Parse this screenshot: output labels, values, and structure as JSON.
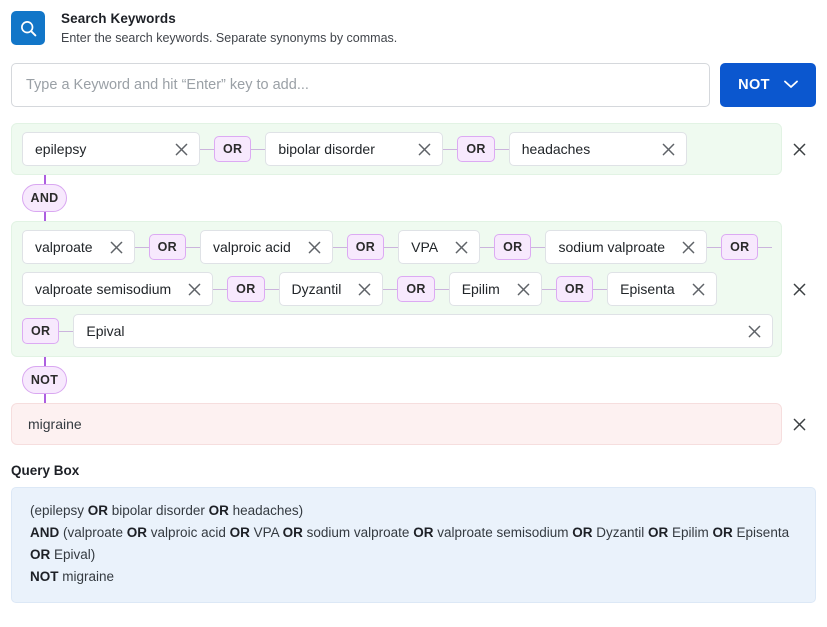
{
  "header": {
    "icon": "search-icon",
    "title": "Search Keywords",
    "subtitle": "Enter the search keywords. Separate synonyms by commas.",
    "icon_color": "#1276c8"
  },
  "search": {
    "value": "",
    "placeholder": "Type a Keyword and hit “Enter” key to add...",
    "operator_button": {
      "label": "NOT",
      "icon": "chevron-down-icon",
      "color": "#0b57cf"
    }
  },
  "builder": {
    "delete_icon": "close-icon",
    "groups": [
      {
        "type": "OR",
        "style": "and-group",
        "rows": [
          {
            "items": [
              {
                "kind": "chip",
                "label": "epilepsy"
              },
              {
                "kind": "op",
                "label": "OR"
              },
              {
                "kind": "chip",
                "label": "bipolar disorder"
              },
              {
                "kind": "op",
                "label": "OR"
              },
              {
                "kind": "chip",
                "label": "headaches"
              }
            ]
          }
        ]
      },
      {
        "type": "OR",
        "style": "and-group",
        "rows": [
          {
            "items": [
              {
                "kind": "chip",
                "label": "valproate"
              },
              {
                "kind": "op",
                "label": "OR"
              },
              {
                "kind": "chip",
                "label": "valproic acid"
              },
              {
                "kind": "op",
                "label": "OR"
              },
              {
                "kind": "chip",
                "label": "VPA"
              },
              {
                "kind": "op",
                "label": "OR"
              },
              {
                "kind": "chip",
                "label": "sodium valproate"
              },
              {
                "kind": "op",
                "label": "OR"
              }
            ]
          },
          {
            "items": [
              {
                "kind": "chip",
                "label": "valproate semisodium"
              },
              {
                "kind": "op",
                "label": "OR"
              },
              {
                "kind": "chip",
                "label": "Dyzantil"
              },
              {
                "kind": "op",
                "label": "OR"
              },
              {
                "kind": "chip",
                "label": "Epilim"
              },
              {
                "kind": "op",
                "label": "OR"
              },
              {
                "kind": "chip",
                "label": "Episenta"
              }
            ]
          },
          {
            "items": [
              {
                "kind": "op",
                "label": "OR"
              },
              {
                "kind": "chip",
                "label": "Epival",
                "stretch": true
              }
            ]
          }
        ]
      }
    ],
    "junctions": {
      "and": "AND",
      "not": "NOT"
    },
    "not_group": {
      "style": "not-group",
      "text": "migraine"
    }
  },
  "query": {
    "title": "Query Box",
    "lines": [
      [
        {
          "t": "(epilepsy ",
          "b": false
        },
        {
          "t": "OR",
          "b": true
        },
        {
          "t": " bipolar disorder ",
          "b": false
        },
        {
          "t": "OR",
          "b": true
        },
        {
          "t": " headaches)",
          "b": false
        }
      ],
      [
        {
          "t": "AND",
          "b": true
        },
        {
          "t": " (valproate ",
          "b": false
        },
        {
          "t": "OR",
          "b": true
        },
        {
          "t": " valproic acid ",
          "b": false
        },
        {
          "t": "OR",
          "b": true
        },
        {
          "t": " VPA ",
          "b": false
        },
        {
          "t": "OR",
          "b": true
        },
        {
          "t": " sodium valproate ",
          "b": false
        },
        {
          "t": "OR",
          "b": true
        },
        {
          "t": " valproate semisodium ",
          "b": false
        },
        {
          "t": "OR",
          "b": true
        },
        {
          "t": " Dyzantil ",
          "b": false
        },
        {
          "t": "OR",
          "b": true
        },
        {
          "t": " Epilim ",
          "b": false
        },
        {
          "t": "OR",
          "b": true
        },
        {
          "t": " Episenta ",
          "b": false
        },
        {
          "t": "OR",
          "b": true
        },
        {
          "t": " Epival)",
          "b": false
        }
      ],
      [
        {
          "t": "NOT",
          "b": true
        },
        {
          "t": " migraine",
          "b": false
        }
      ]
    ]
  }
}
